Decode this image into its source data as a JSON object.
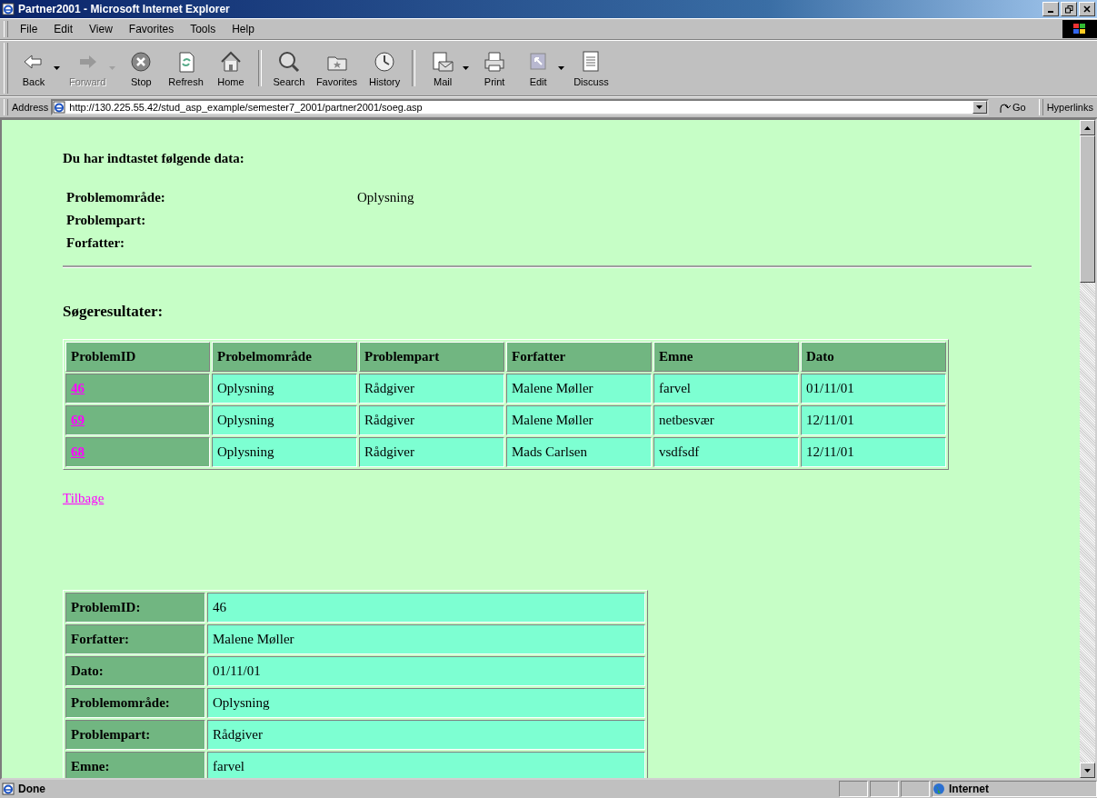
{
  "window": {
    "title": "Partner2001 - Microsoft Internet Explorer"
  },
  "menu": [
    "File",
    "Edit",
    "View",
    "Favorites",
    "Tools",
    "Help"
  ],
  "toolbar": [
    {
      "kind": "back",
      "label": "Back",
      "disabled": false,
      "dropdown": true,
      "group_end": false
    },
    {
      "kind": "forward",
      "label": "Forward",
      "disabled": true,
      "dropdown": true,
      "group_end": false
    },
    {
      "kind": "stop",
      "label": "Stop",
      "disabled": false,
      "dropdown": false,
      "group_end": false
    },
    {
      "kind": "refresh",
      "label": "Refresh",
      "disabled": false,
      "dropdown": false,
      "group_end": false
    },
    {
      "kind": "home",
      "label": "Home",
      "disabled": false,
      "dropdown": false,
      "group_end": true
    },
    {
      "kind": "search",
      "label": "Search",
      "disabled": false,
      "dropdown": false,
      "group_end": false
    },
    {
      "kind": "favorites",
      "label": "Favorites",
      "disabled": false,
      "dropdown": false,
      "group_end": false
    },
    {
      "kind": "history",
      "label": "History",
      "disabled": false,
      "dropdown": false,
      "group_end": true
    },
    {
      "kind": "mail",
      "label": "Mail",
      "disabled": false,
      "dropdown": true,
      "group_end": false
    },
    {
      "kind": "print",
      "label": "Print",
      "disabled": false,
      "dropdown": false,
      "group_end": false
    },
    {
      "kind": "edit",
      "label": "Edit",
      "disabled": false,
      "dropdown": true,
      "group_end": false
    },
    {
      "kind": "discuss",
      "label": "Discuss",
      "disabled": false,
      "dropdown": false,
      "group_end": false
    }
  ],
  "address_bar": {
    "label": "Address",
    "url": "http://130.225.55.42/stud_asp_example/semester7_2001/partner2001/soeg.asp",
    "go": "Go",
    "links": "Hyperlinks"
  },
  "page": {
    "intro": "Du har indtastet følgende data:",
    "entered": [
      {
        "label": "Problemområde:",
        "value": "Oplysning"
      },
      {
        "label": "Problempart:"
      },
      {
        "label": "Forfatter:"
      }
    ],
    "results_title": "Søgeresultater:",
    "results_table": {
      "columns": [
        "ProblemID",
        "Probelmområde",
        "Problempart",
        "Forfatter",
        "Emne",
        "Dato"
      ],
      "rows": [
        [
          "46",
          "Oplysning",
          "Rådgiver",
          "Malene Møller",
          "farvel",
          "01/11/01"
        ],
        [
          "69",
          "Oplysning",
          "Rådgiver",
          "Malene Møller",
          "netbesvær",
          "12/11/01"
        ],
        [
          "68",
          "Oplysning",
          "Rådgiver",
          "Mads Carlsen",
          "vsdfsdf",
          "12/11/01"
        ]
      ]
    },
    "back_link": "Tilbage",
    "detail_table": [
      {
        "label": "ProblemID:",
        "value": "46"
      },
      {
        "label": "Forfatter:",
        "value": "Malene Møller"
      },
      {
        "label": "Dato:",
        "value": "01/11/01"
      },
      {
        "label": "Problemområde:",
        "value": "Oplysning"
      },
      {
        "label": "Problempart:",
        "value": "Rådgiver"
      },
      {
        "label": "Emne:",
        "value": "farvel"
      }
    ]
  },
  "status_bar": {
    "text": "Done",
    "zone": "Internet"
  }
}
